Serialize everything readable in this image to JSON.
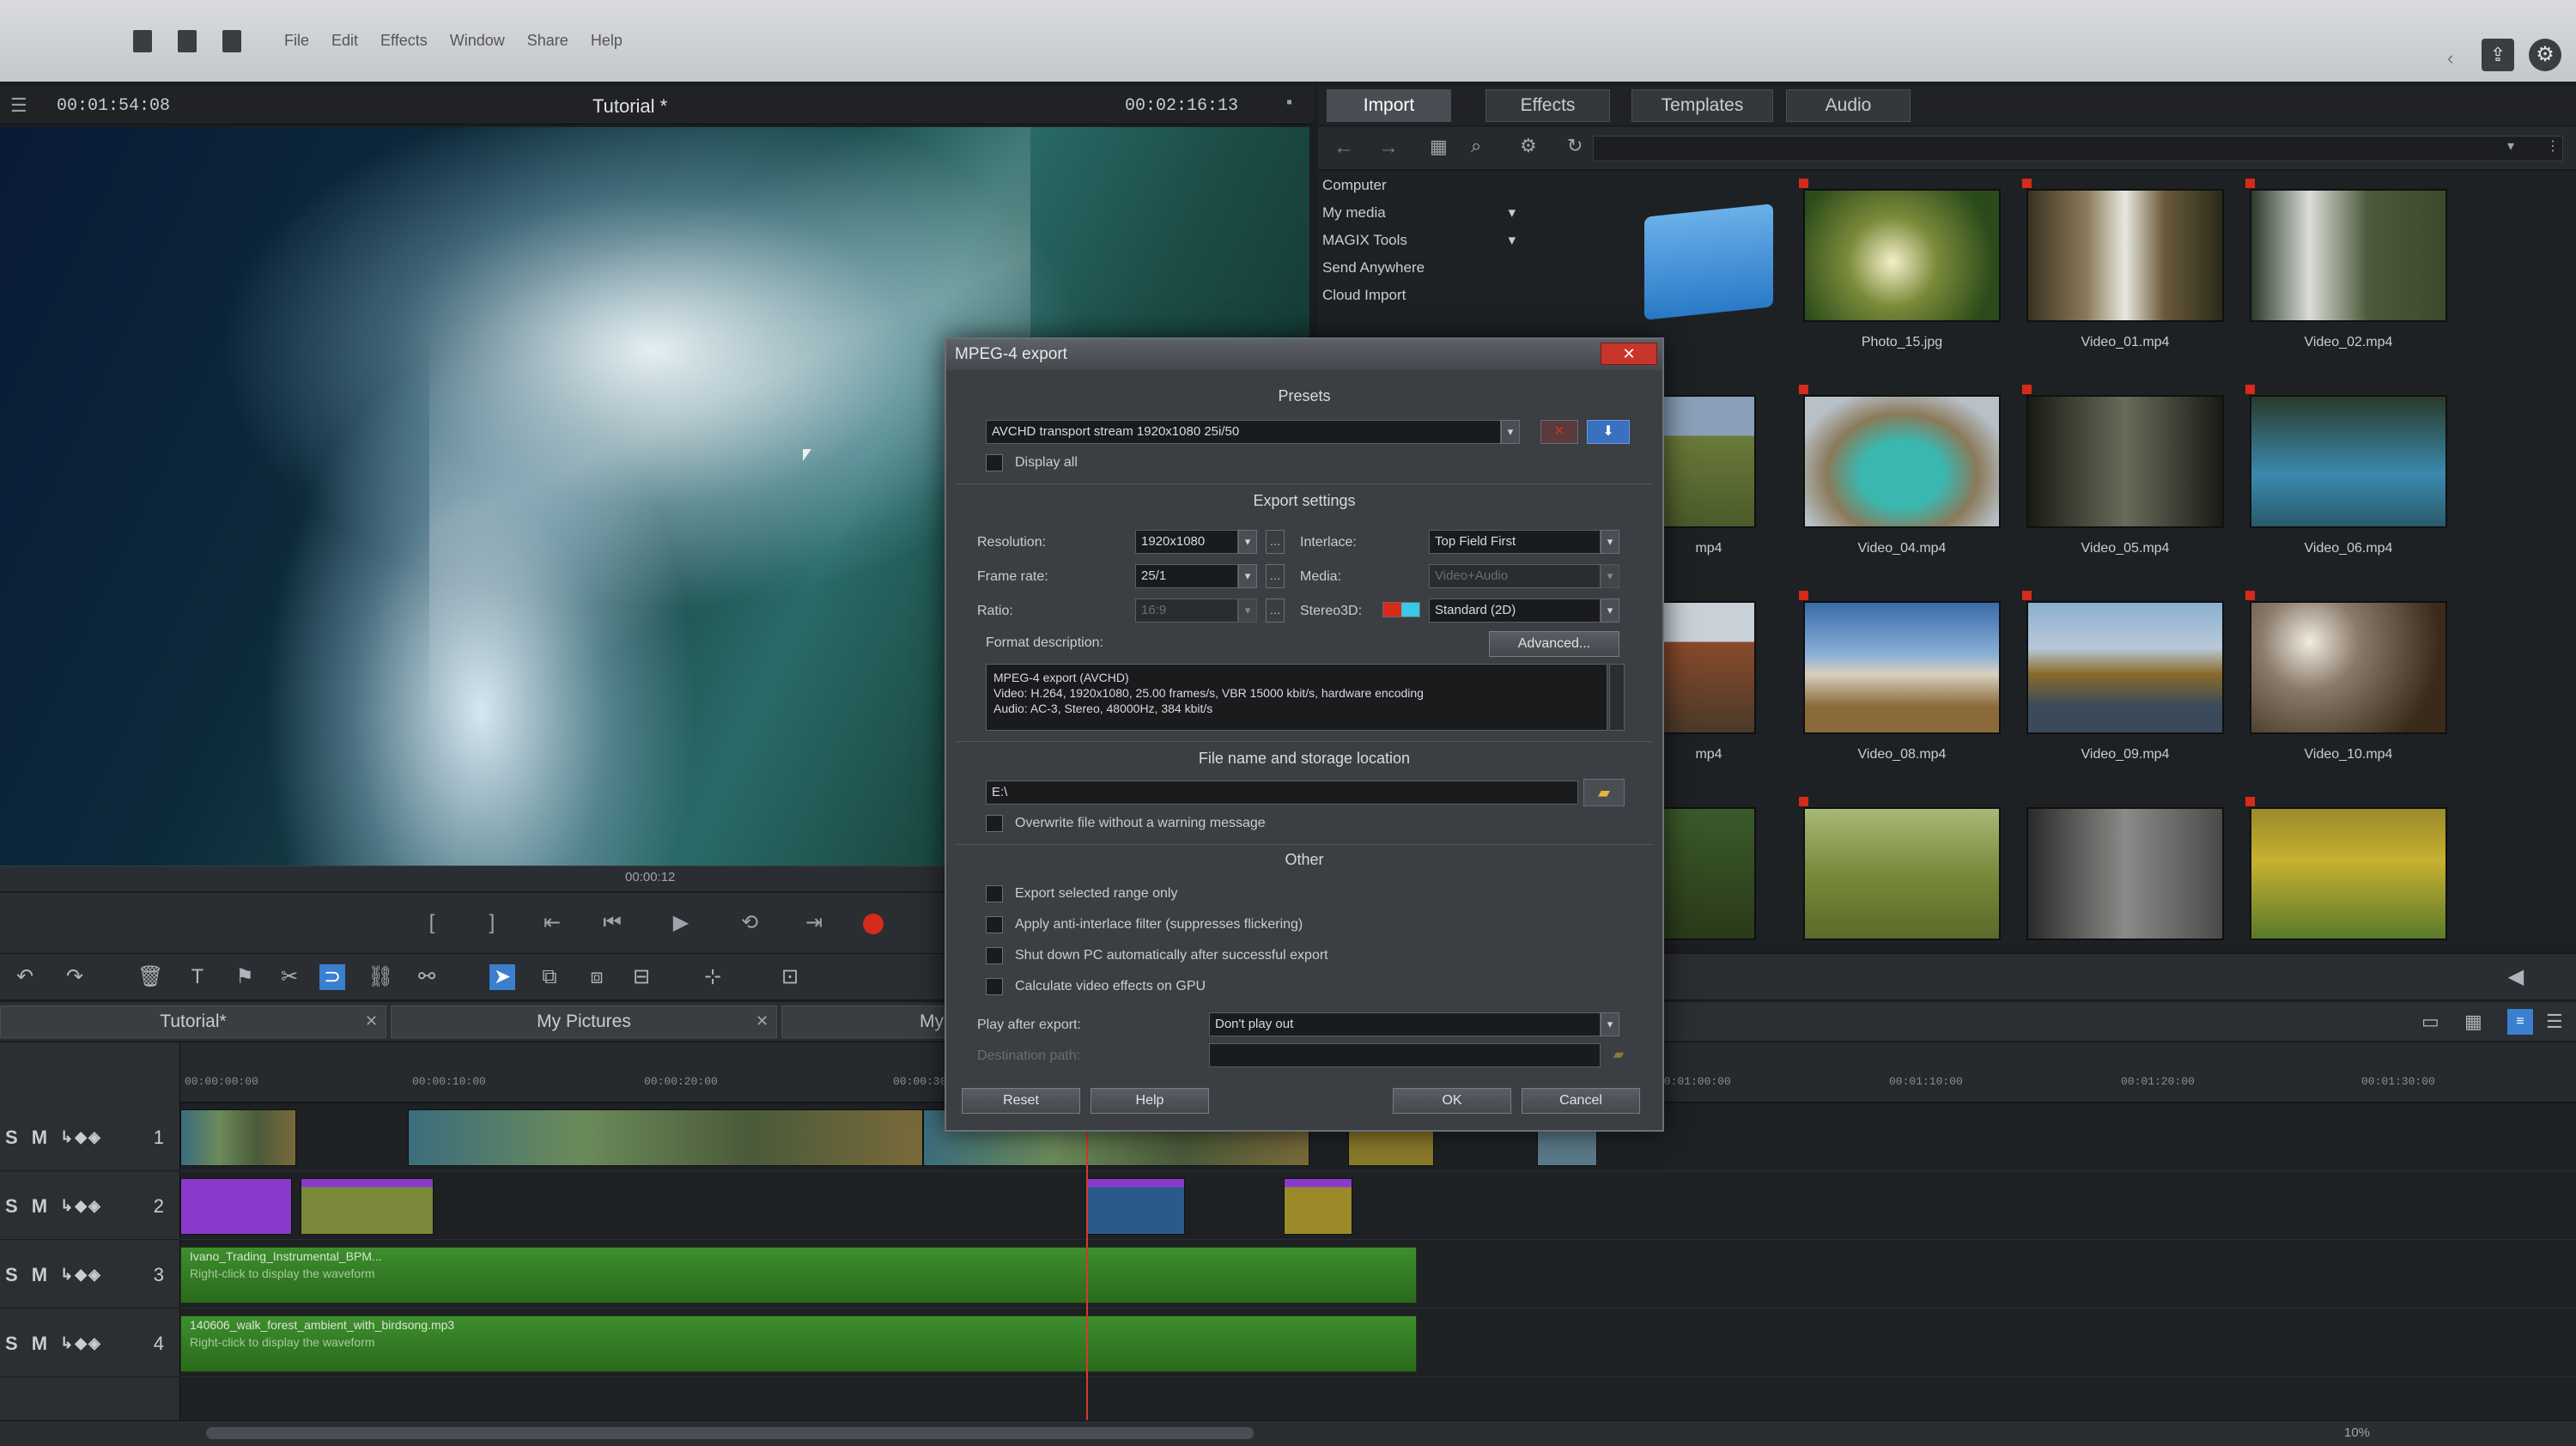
{
  "menubar": {
    "file_icons": [
      "new-file-icon",
      "open-folder-icon",
      "save-icon"
    ],
    "items": [
      "File",
      "Edit",
      "Effects",
      "Window",
      "Share",
      "Help"
    ]
  },
  "preview": {
    "timecode_left": "00:01:54:08",
    "title": "Tutorial *",
    "timecode_right": "00:02:16:13",
    "scrub_time": "00:00:12"
  },
  "pool": {
    "tabs": [
      "Import",
      "Effects",
      "Templates",
      "Audio"
    ],
    "nav": [
      {
        "label": "Computer",
        "has_arrow": false
      },
      {
        "label": "My media",
        "has_arrow": true
      },
      {
        "label": "MAGIX Tools",
        "has_arrow": true
      },
      {
        "label": "Send Anywhere",
        "has_arrow": false
      },
      {
        "label": "Cloud Import",
        "has_arrow": false
      }
    ],
    "thumbnails": [
      {
        "label": "",
        "kind": "folder"
      },
      {
        "label": "Photo_15.jpg",
        "kind": "forest"
      },
      {
        "label": "Video_01.mp4",
        "kind": "waterfall"
      },
      {
        "label": "Video_02.mp4",
        "kind": "waterfall2"
      },
      {
        "label": "mp4",
        "kind": "hills"
      },
      {
        "label": "Video_04.mp4",
        "kind": "lake"
      },
      {
        "label": "Video_05.mp4",
        "kind": "cave"
      },
      {
        "label": "Video_06.mp4",
        "kind": "falls"
      },
      {
        "label": "mp4",
        "kind": "shore"
      },
      {
        "label": "Video_08.mp4",
        "kind": "plane"
      },
      {
        "label": "Video_09.mp4",
        "kind": "valley"
      },
      {
        "label": "Video_10.mp4",
        "kind": "cliff"
      },
      {
        "label": "",
        "kind": "green"
      },
      {
        "label": "",
        "kind": "meadow"
      },
      {
        "label": "",
        "kind": "camera"
      },
      {
        "label": "",
        "kind": "flowers"
      }
    ]
  },
  "dialog": {
    "title": "MPEG-4 export",
    "close_label": "✕",
    "presets_heading": "Presets",
    "preset_value": "AVCHD transport stream 1920x1080 25i/50",
    "display_all": "Display all",
    "export_settings_heading": "Export settings",
    "resolution_label": "Resolution:",
    "resolution_value": "1920x1080",
    "framerate_label": "Frame rate:",
    "framerate_value": "25/1",
    "ratio_label": "Ratio:",
    "ratio_value": "16:9",
    "interlace_label": "Interlace:",
    "interlace_value": "Top Field First",
    "media_label": "Media:",
    "media_value": "Video+Audio",
    "stereo_label": "Stereo3D:",
    "stereo_value": "Standard (2D)",
    "format_desc_label": "Format description:",
    "advanced_button": "Advanced...",
    "format_lines": [
      "MPEG-4 export (AVCHD)",
      "Video: H.264, 1920x1080, 25.00 frames/s, VBR 15000 kbit/s, hardware encoding",
      "Audio: AC-3, Stereo, 48000Hz, 384 kbit/s"
    ],
    "file_heading": "File name and storage location",
    "file_path": "E:\\",
    "overwrite_label": "Overwrite file without a warning message",
    "other_heading": "Other",
    "options": [
      "Export selected range only",
      "Apply anti-interlace filter (suppresses flickering)",
      "Shut down PC automatically after successful export",
      "Calculate video effects on GPU"
    ],
    "play_after_label": "Play after export:",
    "play_after_value": "Don't play out",
    "destination_label": "Destination path:",
    "buttons": {
      "reset": "Reset",
      "help": "Help",
      "ok": "OK",
      "cancel": "Cancel"
    }
  },
  "timeline": {
    "tabs": [
      "Tutorial*",
      "My Pictures",
      "My"
    ],
    "track_numbers": [
      "1",
      "2",
      "3",
      "4"
    ],
    "track_controls": "S M",
    "ruler_labels": [
      "00:00:00:00",
      "00:00:10:00",
      "00:00:20:00",
      "00:00:30:00",
      "00:01:00:00",
      "00:01:10:00",
      "00:01:20:00",
      "00:01:30:00"
    ],
    "audio_clips": [
      {
        "name": "Ivano_Trading_Instrumental_BPM...",
        "sub": "Right-click to display the waveform"
      },
      {
        "name": "140606_walk_forest_ambient_with_birdsong.mp3",
        "sub": "Right-click to display the waveform"
      }
    ],
    "zoom": "10%"
  },
  "colors": {
    "accent_red": "#d62a1a",
    "purple_clip": "#8a3acb",
    "audio_green": "#3e8e2e",
    "playhead": "#d43a2a"
  }
}
